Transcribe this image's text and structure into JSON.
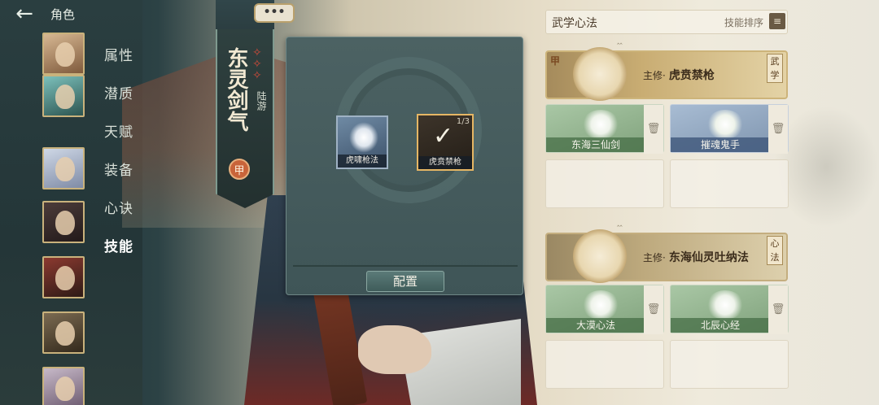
{
  "header": {
    "back_icon": "arrow-left-icon",
    "title": "角色"
  },
  "menu": {
    "items": [
      {
        "label": "属性",
        "active": false
      },
      {
        "label": "潜质",
        "active": false
      },
      {
        "label": "天赋",
        "active": false
      },
      {
        "label": "装备",
        "active": false
      },
      {
        "label": "心诀",
        "active": false
      },
      {
        "label": "技能",
        "active": true
      }
    ]
  },
  "speech_bubble": {
    "text": "•••"
  },
  "character": {
    "name": "东灵剑气",
    "school": "陆游",
    "grade": "甲"
  },
  "popup": {
    "skills": [
      {
        "name": "虎啸枪法",
        "selected": false
      },
      {
        "name": "虎贲禁枪",
        "selected": true,
        "count": "1/3"
      }
    ],
    "config_label": "配置"
  },
  "right_panel": {
    "title": "武学心法",
    "sort_label": "技能排序",
    "martial": {
      "grade": "甲",
      "prefix": "主修·",
      "name": "虎贲禁枪",
      "category": "武学",
      "subs": [
        {
          "name": "东海三仙剑",
          "color": "green"
        },
        {
          "name": "摧魂鬼手",
          "color": "blue"
        }
      ]
    },
    "mind": {
      "prefix": "主修·",
      "name": "东海仙灵吐纳法",
      "category": "心法",
      "subs": [
        {
          "name": "大漠心法",
          "color": "green"
        },
        {
          "name": "北辰心经",
          "color": "green"
        }
      ]
    }
  },
  "colors": {
    "accent_gold": "#cdb47a",
    "panel_teal": "#4c6263",
    "slot_green": "#7ea07a",
    "slot_blue": "#7d93ad"
  }
}
